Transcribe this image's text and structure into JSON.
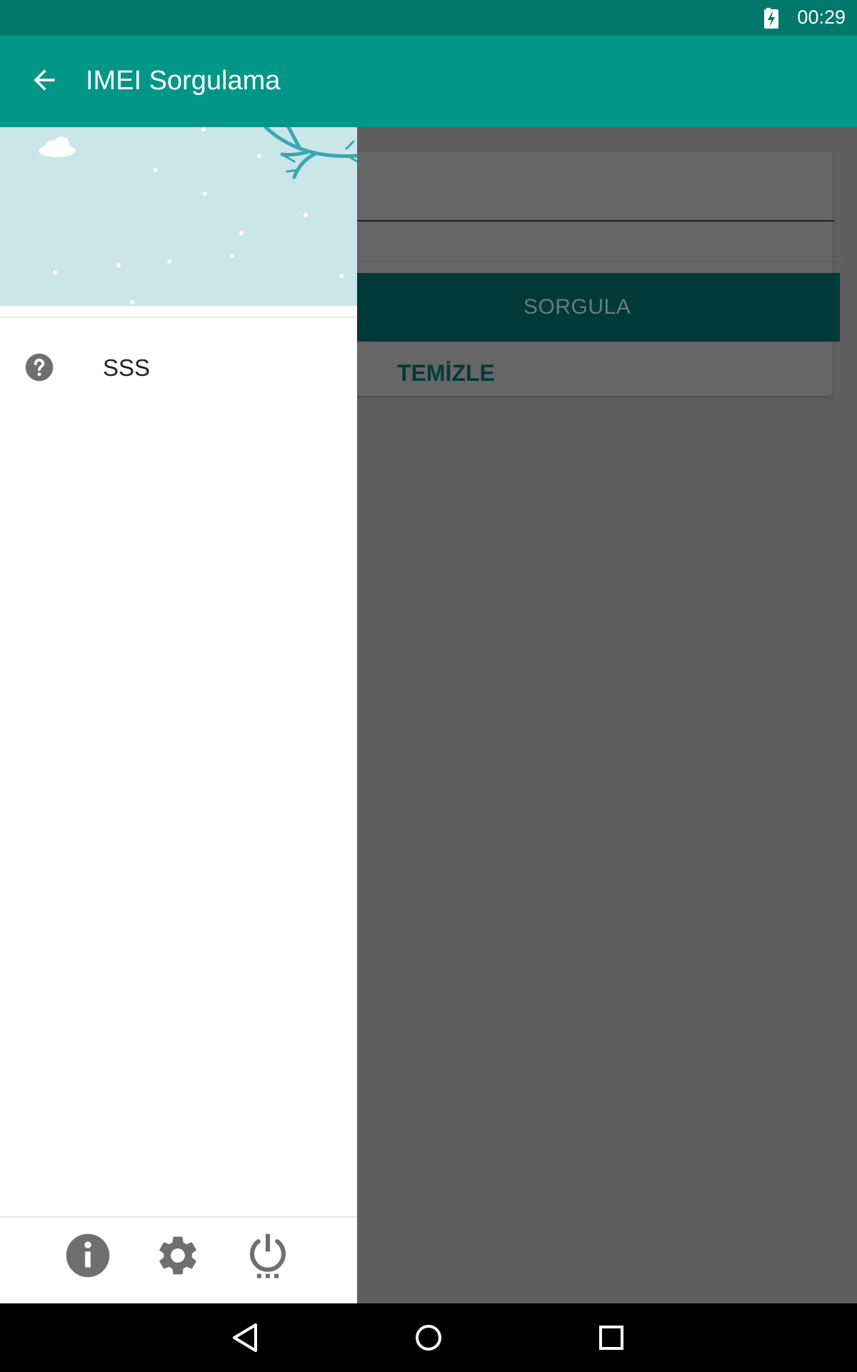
{
  "status_bar": {
    "time": "00:29",
    "battery_icon": "battery-charging-icon"
  },
  "app_bar": {
    "title": "IMEI Sorgulama",
    "back_icon": "arrow-back-icon"
  },
  "main": {
    "imei_input": {
      "value": "",
      "placeholder": ""
    },
    "query_button_label": "SORGULA",
    "clear_button_label": "TEMİZLE"
  },
  "drawer": {
    "header_image": "winter-branch-illustration",
    "items": [
      {
        "label": "SSS",
        "icon": "help-circle-icon"
      }
    ],
    "footer_icons": [
      "info-icon",
      "settings-gear-icon",
      "power-icon"
    ]
  },
  "nav_bar": {
    "buttons": [
      "back-triangle-icon",
      "home-circle-icon",
      "recents-square-icon"
    ]
  },
  "colors": {
    "status_bar": "#00786c",
    "app_bar": "#009688",
    "accent_dark": "#003a38",
    "scrim": "#5f5f5f",
    "drawer_header": "#cae6e8"
  }
}
